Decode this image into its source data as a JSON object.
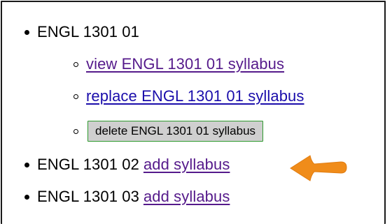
{
  "courses": [
    {
      "label": "ENGL 1301 01",
      "actions": {
        "view_link": "view ENGL 1301 01 syllabus",
        "replace_link": "replace ENGL 1301 01 syllabus",
        "delete_button": "delete ENGL 1301 01 syllabus"
      }
    },
    {
      "label": "ENGL 1301 02",
      "add_link": "add syllabus"
    },
    {
      "label": "ENGL 1301 03",
      "add_link": "add syllabus"
    }
  ],
  "colors": {
    "visited_link": "#551a8b",
    "unvisited_link": "#1a0dab",
    "arrow": "#f08c1a",
    "button_border": "#2e9a2e",
    "button_fill": "#cfcfcf"
  },
  "icons": {
    "annotation": "orange-arrow-icon"
  }
}
